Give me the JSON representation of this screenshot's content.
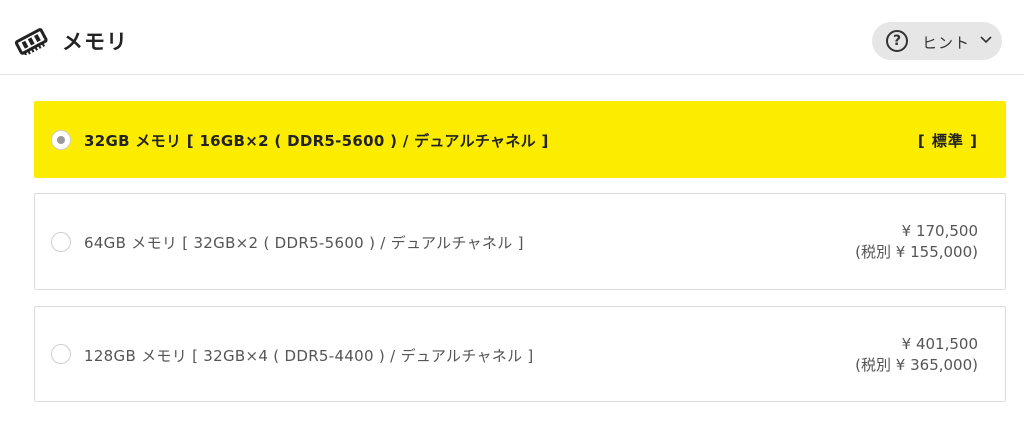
{
  "header": {
    "title": "メモリ",
    "icon": "memory-module-icon",
    "hint": {
      "label": "ヒント",
      "icon": "question-circle-icon",
      "chevron": "chevron-down-icon"
    }
  },
  "options": [
    {
      "label": "32GB メモリ [ 16GB×2 ( DDR5-5600 ) / デュアルチャネル ]",
      "tag": "[ 標準 ]",
      "selected": true
    },
    {
      "label": "64GB メモリ [ 32GB×2 ( DDR5-5600 ) / デュアルチャネル ]",
      "price": "¥ 170,500",
      "price_excl_tax": "(税別 ¥ 155,000)",
      "selected": false
    },
    {
      "label": "128GB メモリ [ 32GB×4 ( DDR5-4400 ) / デュアルチャネル ]",
      "price": "¥ 401,500",
      "price_excl_tax": "(税別 ¥ 365,000)",
      "selected": false
    }
  ],
  "colors": {
    "selected_bg": "#fcec00",
    "border": "#dddddd",
    "hint_bg": "#e6e6e6"
  }
}
